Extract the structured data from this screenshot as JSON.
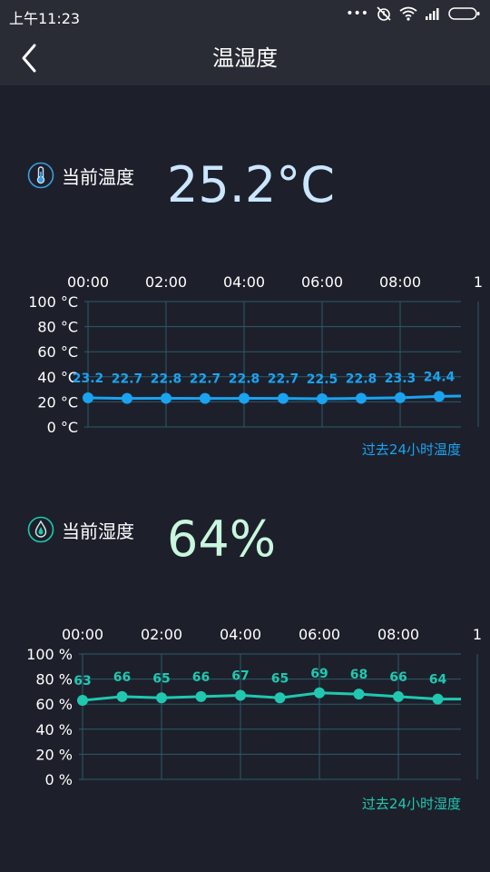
{
  "status_bar": {
    "time": "上午11:23"
  },
  "header": {
    "title": "温湿度"
  },
  "temperature": {
    "label": "当前温度",
    "value": "25.2°C",
    "caption": "过去24小时温度",
    "chart_data": {
      "type": "line",
      "x": [
        "00:00",
        "01:00",
        "02:00",
        "03:00",
        "04:00",
        "05:00",
        "06:00",
        "07:00",
        "08:00",
        "09:00",
        "10:00"
      ],
      "x_tick_labels": [
        "00:00",
        "02:00",
        "04:00",
        "06:00",
        "08:00",
        "1"
      ],
      "values": [
        23.2,
        22.7,
        22.8,
        22.7,
        22.8,
        22.7,
        22.5,
        22.8,
        23.3,
        24.4,
        24.6
      ],
      "data_labels": [
        "23.2",
        "22.7",
        "22.8",
        "22.7",
        "22.8",
        "22.7",
        "22.5",
        "22.8",
        "23.3",
        "24.4"
      ],
      "y_tick_labels": [
        "100 °C",
        "80 °C",
        "60 °C",
        "40 °C",
        "20 °C",
        "0 °C"
      ],
      "ylim": [
        0,
        100
      ],
      "grid": true,
      "color": "#1aa3f0"
    }
  },
  "humidity": {
    "label": "当前湿度",
    "value": "64%",
    "caption": "过去24小时湿度",
    "chart_data": {
      "type": "line",
      "x": [
        "00:00",
        "01:00",
        "02:00",
        "03:00",
        "04:00",
        "05:00",
        "06:00",
        "07:00",
        "08:00",
        "09:00",
        "10:00"
      ],
      "x_tick_labels": [
        "00:00",
        "02:00",
        "04:00",
        "06:00",
        "08:00",
        "1"
      ],
      "values": [
        63,
        66,
        65,
        66,
        67,
        65,
        69,
        68,
        66,
        64,
        64
      ],
      "data_labels": [
        "63",
        "66",
        "65",
        "66",
        "67",
        "65",
        "69",
        "68",
        "66",
        "64"
      ],
      "y_tick_labels": [
        "100 %",
        "80 %",
        "60 %",
        "40 %",
        "20 %",
        "0 %"
      ],
      "ylim": [
        0,
        100
      ],
      "grid": true,
      "color": "#20c8b0"
    }
  },
  "colors": {
    "background": "#1d202b",
    "bar": "#2a2c35",
    "grid": "#2c5a6a",
    "temp_caption": "#1aa3f0",
    "hum_caption": "#20c8b0"
  }
}
